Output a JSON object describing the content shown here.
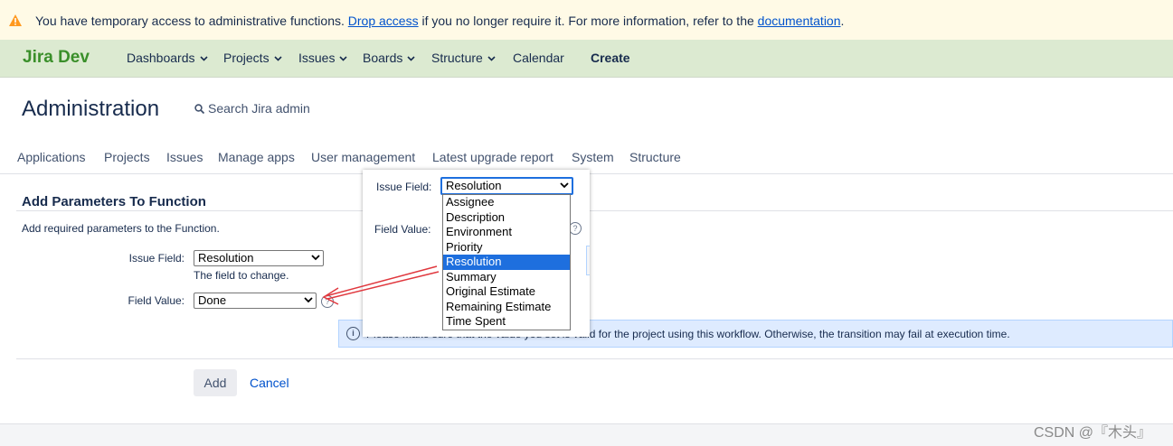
{
  "banner": {
    "text_before": "You have temporary access to administrative functions.",
    "drop_access_link": "Drop access",
    "text_middle": "if you no longer require it. For more information, refer to the",
    "documentation_link": "documentation",
    "text_after": ".",
    "icon": "warning-icon"
  },
  "topnav": {
    "brand": "Jira Dev",
    "items": [
      {
        "label": "Dashboards",
        "dropdown": true
      },
      {
        "label": "Projects",
        "dropdown": true
      },
      {
        "label": "Issues",
        "dropdown": true
      },
      {
        "label": "Boards",
        "dropdown": true
      },
      {
        "label": "Structure",
        "dropdown": true
      },
      {
        "label": "Calendar",
        "dropdown": false
      }
    ],
    "create_label": "Create"
  },
  "admin": {
    "title": "Administration",
    "search_label": "Search Jira admin",
    "tabs": [
      "Applications",
      "Projects",
      "Issues",
      "Manage apps",
      "User management",
      "Latest upgrade report",
      "System",
      "Structure"
    ]
  },
  "form": {
    "title": "Add Parameters To Function",
    "description": "Add required parameters to the Function.",
    "issue_field_label": "Issue Field:",
    "issue_field_value": "Resolution",
    "issue_field_hint": "The field to change.",
    "field_value_label": "Field Value:",
    "field_value_value": "Done",
    "info_text": "Please make sure that the value you set is valid for the project using this workflow. Otherwise, the transition may fail at execution time.",
    "info_text_visible_start": "Please make sure that the value you set is",
    "info_text_visible_end": "valid for the project using this workflow. Otherwise, the transition may fail at execution time.",
    "add_label": "Add",
    "cancel_label": "Cancel"
  },
  "popup": {
    "issue_field_label": "Issue Field:",
    "issue_field_value": "Resolution",
    "field_value_label": "Field Value:",
    "options": [
      "Assignee",
      "Description",
      "Environment",
      "Priority",
      "Resolution",
      "Summary",
      "Original Estimate",
      "Remaining Estimate",
      "Time Spent"
    ],
    "highlighted_option": "Resolution"
  },
  "annotation": {
    "color": "#e0383e"
  },
  "watermark": "CSDN @『木头』",
  "colors": {
    "banner_bg": "#fffae6",
    "nav_bg": "#dcead1",
    "brand": "#3a8f2a",
    "link": "#0052cc",
    "info_bg": "#deebff",
    "highlight": "#1e6fde"
  }
}
